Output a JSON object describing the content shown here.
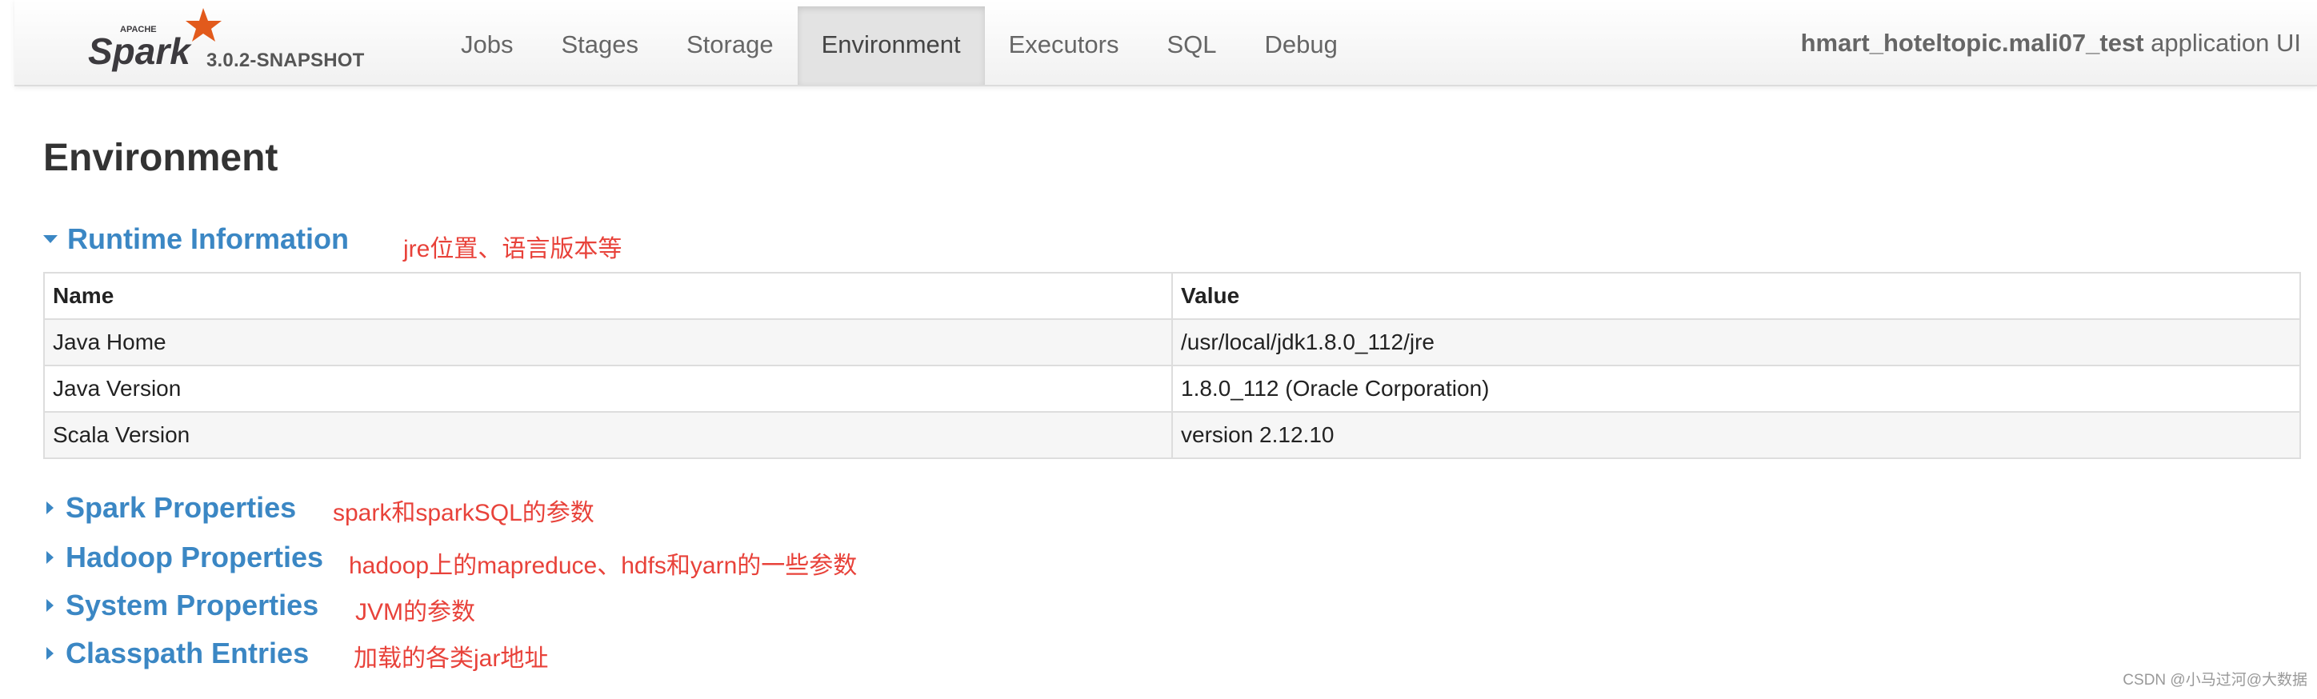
{
  "navbar": {
    "logo_small_text": "APACHE",
    "logo_text": "Spark",
    "version": "3.0.2-SNAPSHOT",
    "tabs": [
      {
        "label": "Jobs",
        "active": false
      },
      {
        "label": "Stages",
        "active": false
      },
      {
        "label": "Storage",
        "active": false
      },
      {
        "label": "Environment",
        "active": true
      },
      {
        "label": "Executors",
        "active": false
      },
      {
        "label": "SQL",
        "active": false
      },
      {
        "label": "Debug",
        "active": false
      }
    ],
    "app_name": "hmart_hoteltopic.mali07_test",
    "app_suffix": " application UI"
  },
  "page": {
    "title": "Environment"
  },
  "sections": {
    "runtime": {
      "label": "Runtime Information",
      "expanded": true,
      "note": "jre位置、语言版本等"
    },
    "spark": {
      "label": "Spark Properties",
      "expanded": false,
      "note": "spark和sparkSQL的参数"
    },
    "hadoop": {
      "label": "Hadoop Properties",
      "expanded": false,
      "note": "hadoop上的mapreduce、hdfs和yarn的一些参数"
    },
    "system": {
      "label": "System Properties",
      "expanded": false,
      "note": "JVM的参数"
    },
    "classpath": {
      "label": "Classpath Entries",
      "expanded": false,
      "note": "加载的各类jar地址"
    }
  },
  "runtime_table": {
    "headers": [
      "Name",
      "Value"
    ],
    "rows": [
      [
        "Java Home",
        "/usr/local/jdk1.8.0_112/jre"
      ],
      [
        "Java Version",
        "1.8.0_112 (Oracle Corporation)"
      ],
      [
        "Scala Version",
        "version 2.12.10"
      ]
    ]
  },
  "footer": {
    "credit": "CSDN @小马过河@大数据"
  },
  "colors": {
    "link": "#3b87c4",
    "annotation": "#e8423a",
    "logo_orange": "#e25a1c",
    "logo_dark": "#3c3a3e"
  }
}
